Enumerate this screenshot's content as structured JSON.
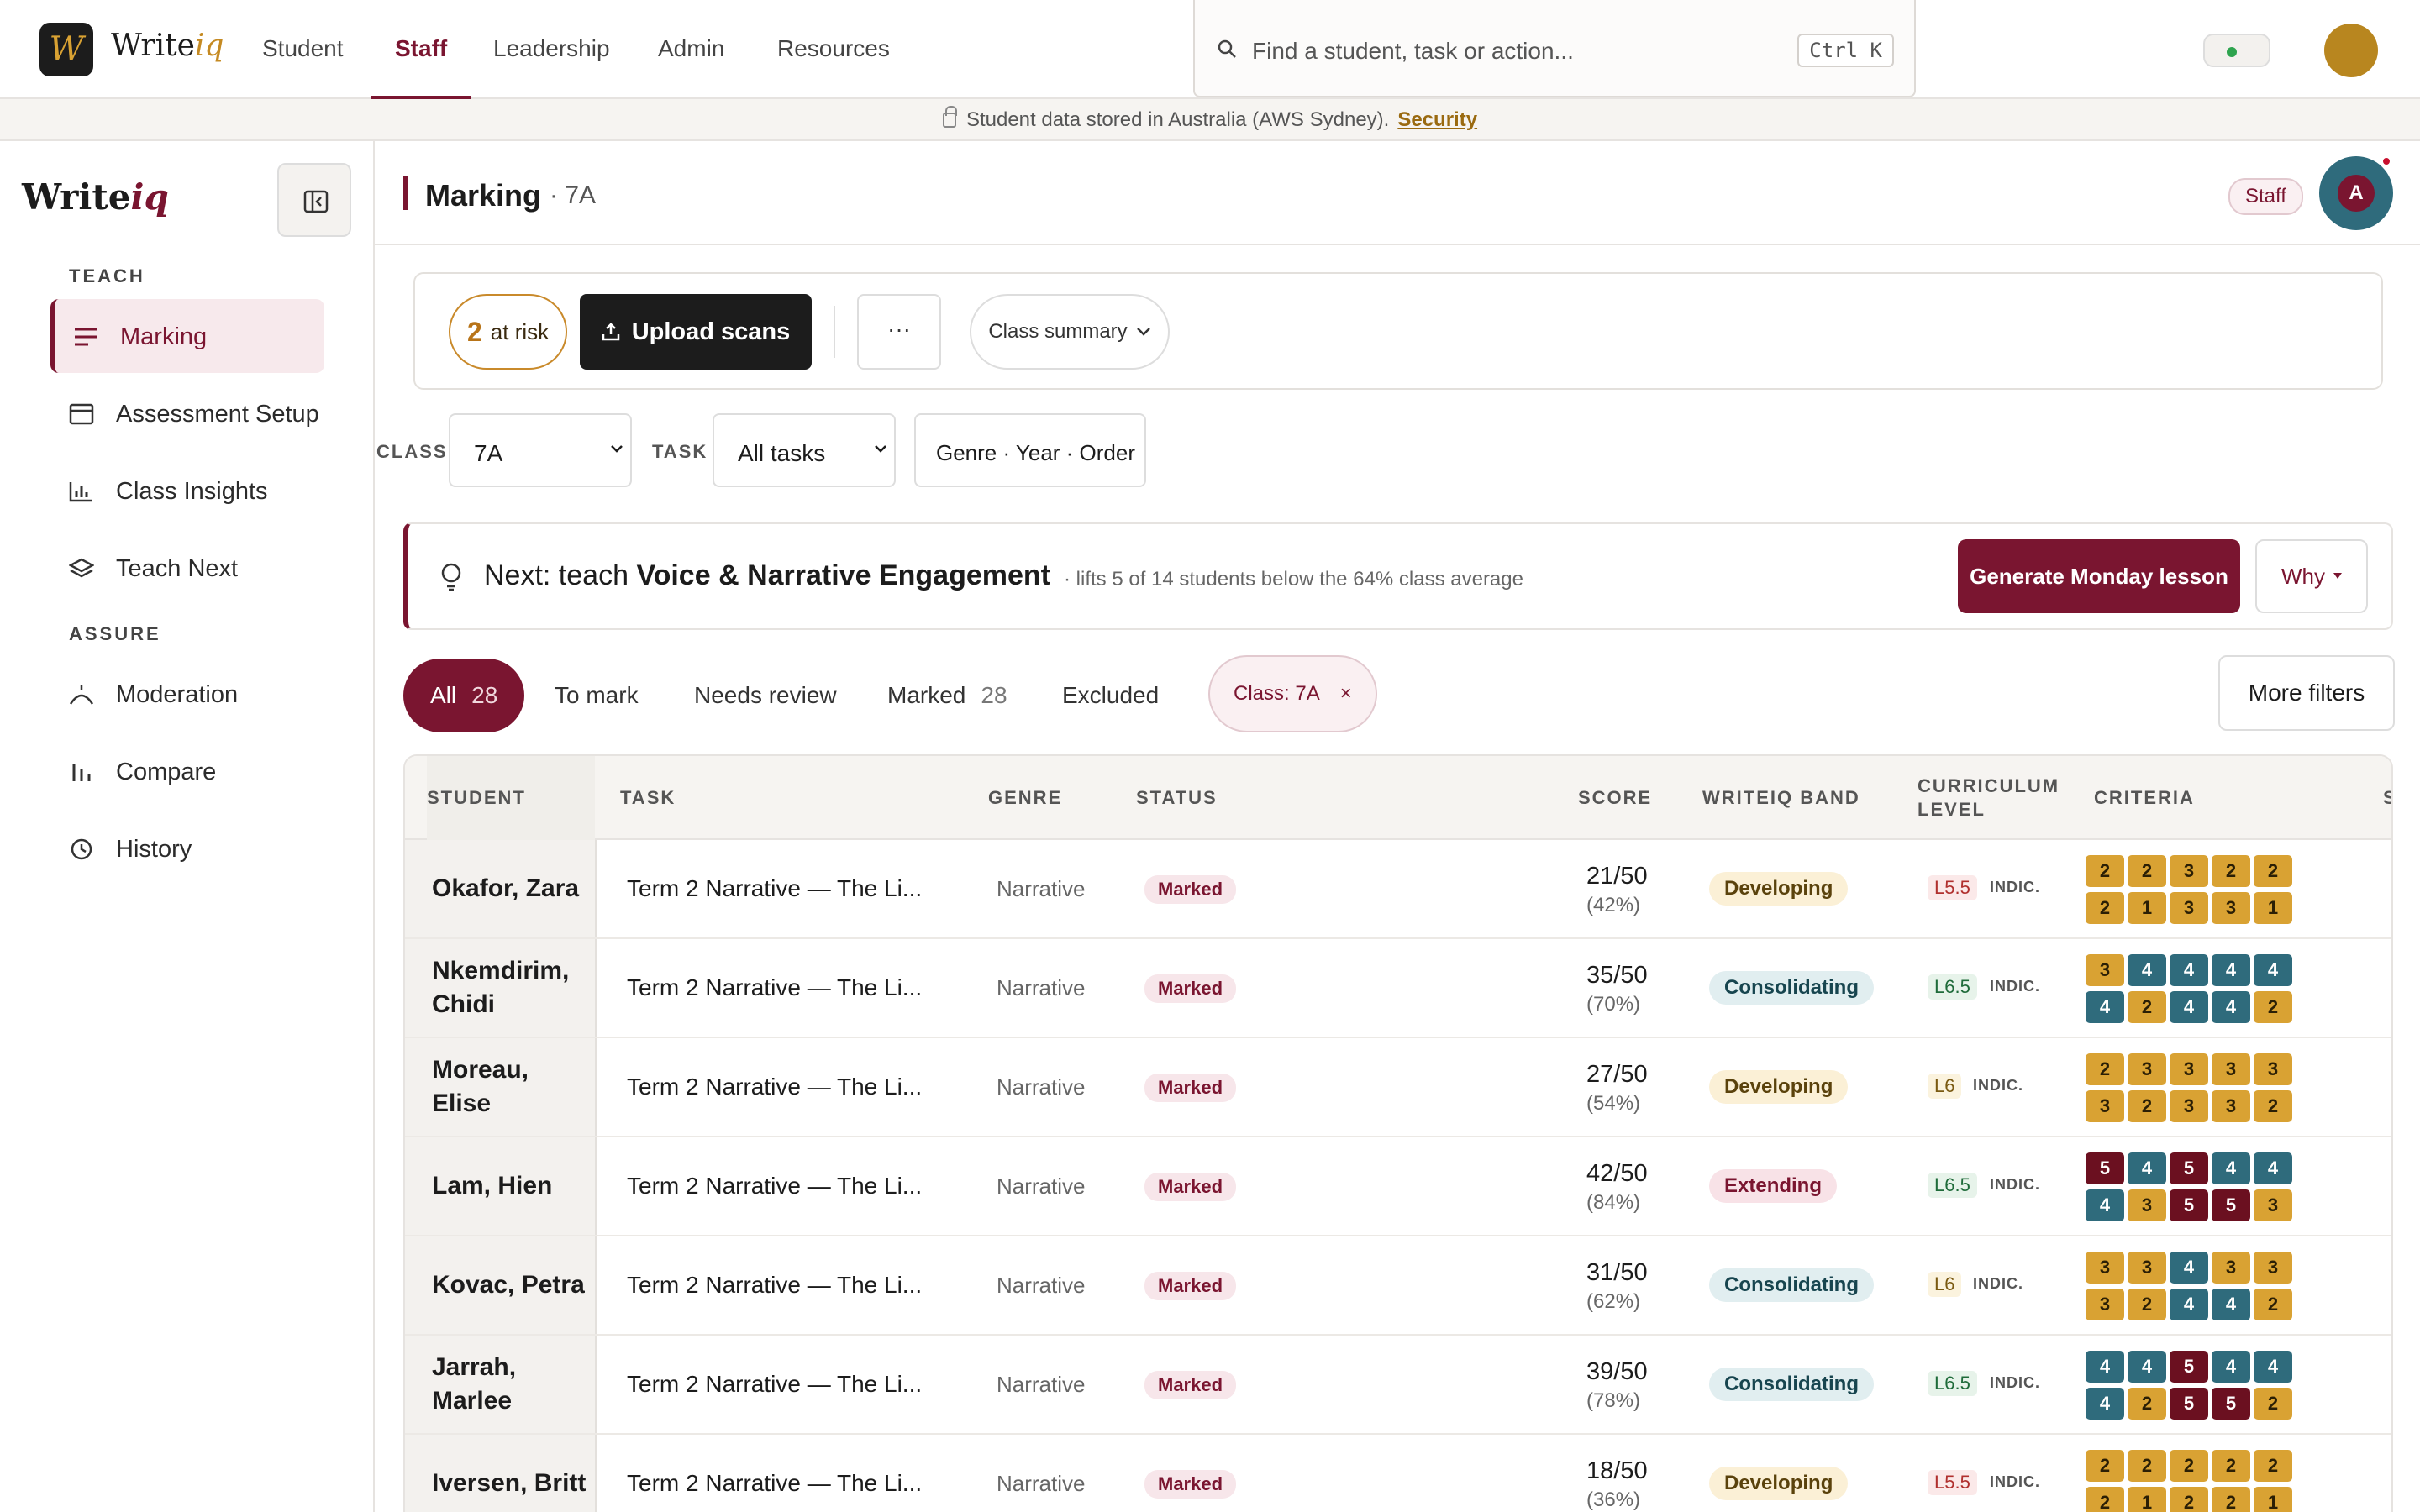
{
  "app": {
    "logo_letter": "W",
    "name_main": "Write",
    "name_accent": "iq"
  },
  "topnav": {
    "tabs": [
      "Student",
      "Staff",
      "Leadership",
      "Admin",
      "Resources"
    ],
    "active": "Staff"
  },
  "search": {
    "placeholder": "Find a student, task or action...",
    "shortcut": "Ctrl K"
  },
  "notice": {
    "text": "Student data stored in Australia (AWS Sydney).",
    "link": "Security"
  },
  "sidebar": {
    "sections": [
      {
        "title": "TEACH",
        "items": [
          "Marking",
          "Assessment Setup",
          "Class Insights",
          "Teach Next"
        ]
      },
      {
        "title": "ASSURE",
        "items": [
          "Moderation",
          "Compare",
          "History"
        ]
      }
    ],
    "active": "Marking"
  },
  "header": {
    "title": "Marking",
    "subtitle": "· 7A",
    "role_chip": "Staff",
    "avatar_initial": "A"
  },
  "toolbar": {
    "risk_count": "2",
    "risk_label": "at risk",
    "upload_label": "Upload scans",
    "more_label": "···",
    "summary_label": "Class summary"
  },
  "filters": {
    "class_label": "CLASS",
    "class_value": "7A",
    "task_label": "TASK",
    "task_value": "All tasks",
    "sort_label": "Genre · Year · Order"
  },
  "next_card": {
    "prefix": "Next: teach",
    "focus": "Voice & Narrative Engagement",
    "note": "· lifts 5 of 14 students below the 64% class average",
    "generate_label": "Generate Monday lesson",
    "why_label": "Why"
  },
  "tabs": [
    {
      "label": "All",
      "count": "28"
    },
    {
      "label": "To mark",
      "count": ""
    },
    {
      "label": "Needs review",
      "count": ""
    },
    {
      "label": "Marked",
      "count": "28"
    },
    {
      "label": "Excluded",
      "count": ""
    }
  ],
  "chip": {
    "label": "Class: 7A",
    "close": "×"
  },
  "more_filters": "More filters",
  "table": {
    "columns": [
      "STUDENT",
      "TASK",
      "GENRE",
      "STATUS",
      "SCORE",
      "WRITEIQ BAND",
      "CURRICULUM LEVEL",
      "CRITERIA",
      "S"
    ],
    "rows": [
      {
        "student": "Okafor, Zara",
        "task": "Term 2 Narrative — The Li...",
        "genre": "Narrative",
        "status": "Marked",
        "score": "21/50",
        "pct": "(42%)",
        "band": "Developing",
        "level": "L5.5",
        "indic": "INDIC.",
        "criteria": [
          [
            2,
            2,
            3,
            2,
            2
          ],
          [
            2,
            1,
            3,
            3,
            1
          ]
        ]
      },
      {
        "student": "Nkemdirim, Chidi",
        "task": "Term 2 Narrative — The Li...",
        "genre": "Narrative",
        "status": "Marked",
        "score": "35/50",
        "pct": "(70%)",
        "band": "Consolidating",
        "level": "L6.5",
        "indic": "INDIC.",
        "criteria": [
          [
            3,
            4,
            4,
            4,
            4
          ],
          [
            4,
            2,
            4,
            4,
            2
          ]
        ]
      },
      {
        "student": "Moreau, Elise",
        "task": "Term 2 Narrative — The Li...",
        "genre": "Narrative",
        "status": "Marked",
        "score": "27/50",
        "pct": "(54%)",
        "band": "Developing",
        "level": "L6",
        "indic": "INDIC.",
        "criteria": [
          [
            2,
            3,
            3,
            3,
            3
          ],
          [
            3,
            2,
            3,
            3,
            2
          ]
        ]
      },
      {
        "student": "Lam, Hien",
        "task": "Term 2 Narrative — The Li...",
        "genre": "Narrative",
        "status": "Marked",
        "score": "42/50",
        "pct": "(84%)",
        "band": "Extending",
        "level": "L6.5",
        "indic": "INDIC.",
        "criteria": [
          [
            5,
            4,
            5,
            4,
            4
          ],
          [
            4,
            3,
            5,
            5,
            3
          ]
        ]
      },
      {
        "student": "Kovac, Petra",
        "task": "Term 2 Narrative — The Li...",
        "genre": "Narrative",
        "status": "Marked",
        "score": "31/50",
        "pct": "(62%)",
        "band": "Consolidating",
        "level": "L6",
        "indic": "INDIC.",
        "criteria": [
          [
            3,
            3,
            4,
            3,
            3
          ],
          [
            3,
            2,
            4,
            4,
            2
          ]
        ]
      },
      {
        "student": "Jarrah, Marlee",
        "task": "Term 2 Narrative — The Li...",
        "genre": "Narrative",
        "status": "Marked",
        "score": "39/50",
        "pct": "(78%)",
        "band": "Consolidating",
        "level": "L6.5",
        "indic": "INDIC.",
        "criteria": [
          [
            4,
            4,
            5,
            4,
            4
          ],
          [
            4,
            2,
            5,
            5,
            2
          ]
        ]
      },
      {
        "student": "Iversen, Britt",
        "task": "Term 2 Narrative — The Li...",
        "genre": "Narrative",
        "status": "Marked",
        "score": "18/50",
        "pct": "(36%)",
        "band": "Developing",
        "level": "L5.5",
        "indic": "INDIC.",
        "criteria": [
          [
            2,
            2,
            2,
            2,
            2
          ],
          [
            2,
            1,
            2,
            2,
            1
          ]
        ]
      }
    ]
  },
  "colors": {
    "accent": "#7a1530",
    "gold": "#d9a233",
    "teal": "#2f6b7c",
    "dark": "#1c1c1c"
  }
}
